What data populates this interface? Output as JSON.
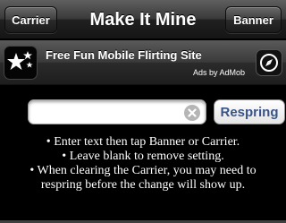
{
  "navbar": {
    "title": "Make It Mine",
    "left_button": "Carrier",
    "right_button": "Banner"
  },
  "ad": {
    "text": "Free Fun Mobile Flirting Site",
    "attribution": "Ads by AdMob",
    "icon": "sparkle-icon",
    "action_icon": "compass-icon"
  },
  "form": {
    "input_value": "",
    "input_placeholder": "",
    "respring_label": "Respring"
  },
  "instructions": [
    "• Enter text then tap Banner or Carrier.",
    "• Leave blank to remove setting.",
    "• When clearing the Carrier, you may need to",
    "respring before the change will show up."
  ],
  "colors": {
    "background": "#000000",
    "respring_text": "#385487"
  }
}
